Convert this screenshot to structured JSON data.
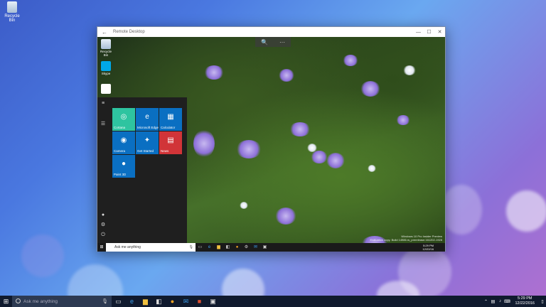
{
  "desktop": {
    "recycle_bin_label": "Recycle Bin"
  },
  "window": {
    "title": "Remote Desktop",
    "back_glyph": "←",
    "minimize_glyph": "—",
    "maximize_glyph": "☐",
    "close_glyph": "✕"
  },
  "remote_toolbar": {
    "zoom_glyph": "🔍",
    "more_glyph": "···"
  },
  "remote_desktop": {
    "icons": [
      {
        "label": "Recycle Bin"
      },
      {
        "label": "Skype"
      },
      {
        "label": ""
      }
    ],
    "start_menu": {
      "tiles": [
        {
          "label": "Cortana",
          "icon": "◎",
          "color": "#2ec4a0"
        },
        {
          "label": "Microsoft Edge",
          "icon": "e",
          "color": "#0a6fc2"
        },
        {
          "label": "Calculator",
          "icon": "▦",
          "color": "#0a6fc2"
        },
        {
          "label": "Camera",
          "icon": "◉",
          "color": "#0a6fc2"
        },
        {
          "label": "Get Started",
          "icon": "✦",
          "color": "#0a6fc2"
        },
        {
          "label": "News",
          "icon": "▤",
          "color": "#d13438"
        },
        {
          "label": "Paint 3D",
          "icon": "●",
          "color": "#0a6fc2"
        }
      ]
    },
    "search_placeholder": "Ask me anything",
    "clock_time": "5:29 PM",
    "clock_date": "12/22/16",
    "watermark_line1": "Windows 10 Pro Insider Preview",
    "watermark_line2": "Evaluation copy. Build 14986.rs_prerelease.161202-1928"
  },
  "taskbar": {
    "search_placeholder": "Ask me anything",
    "clock_time": "5:29 PM",
    "clock_date": "12/22/2016",
    "accent": "#101a2e"
  }
}
